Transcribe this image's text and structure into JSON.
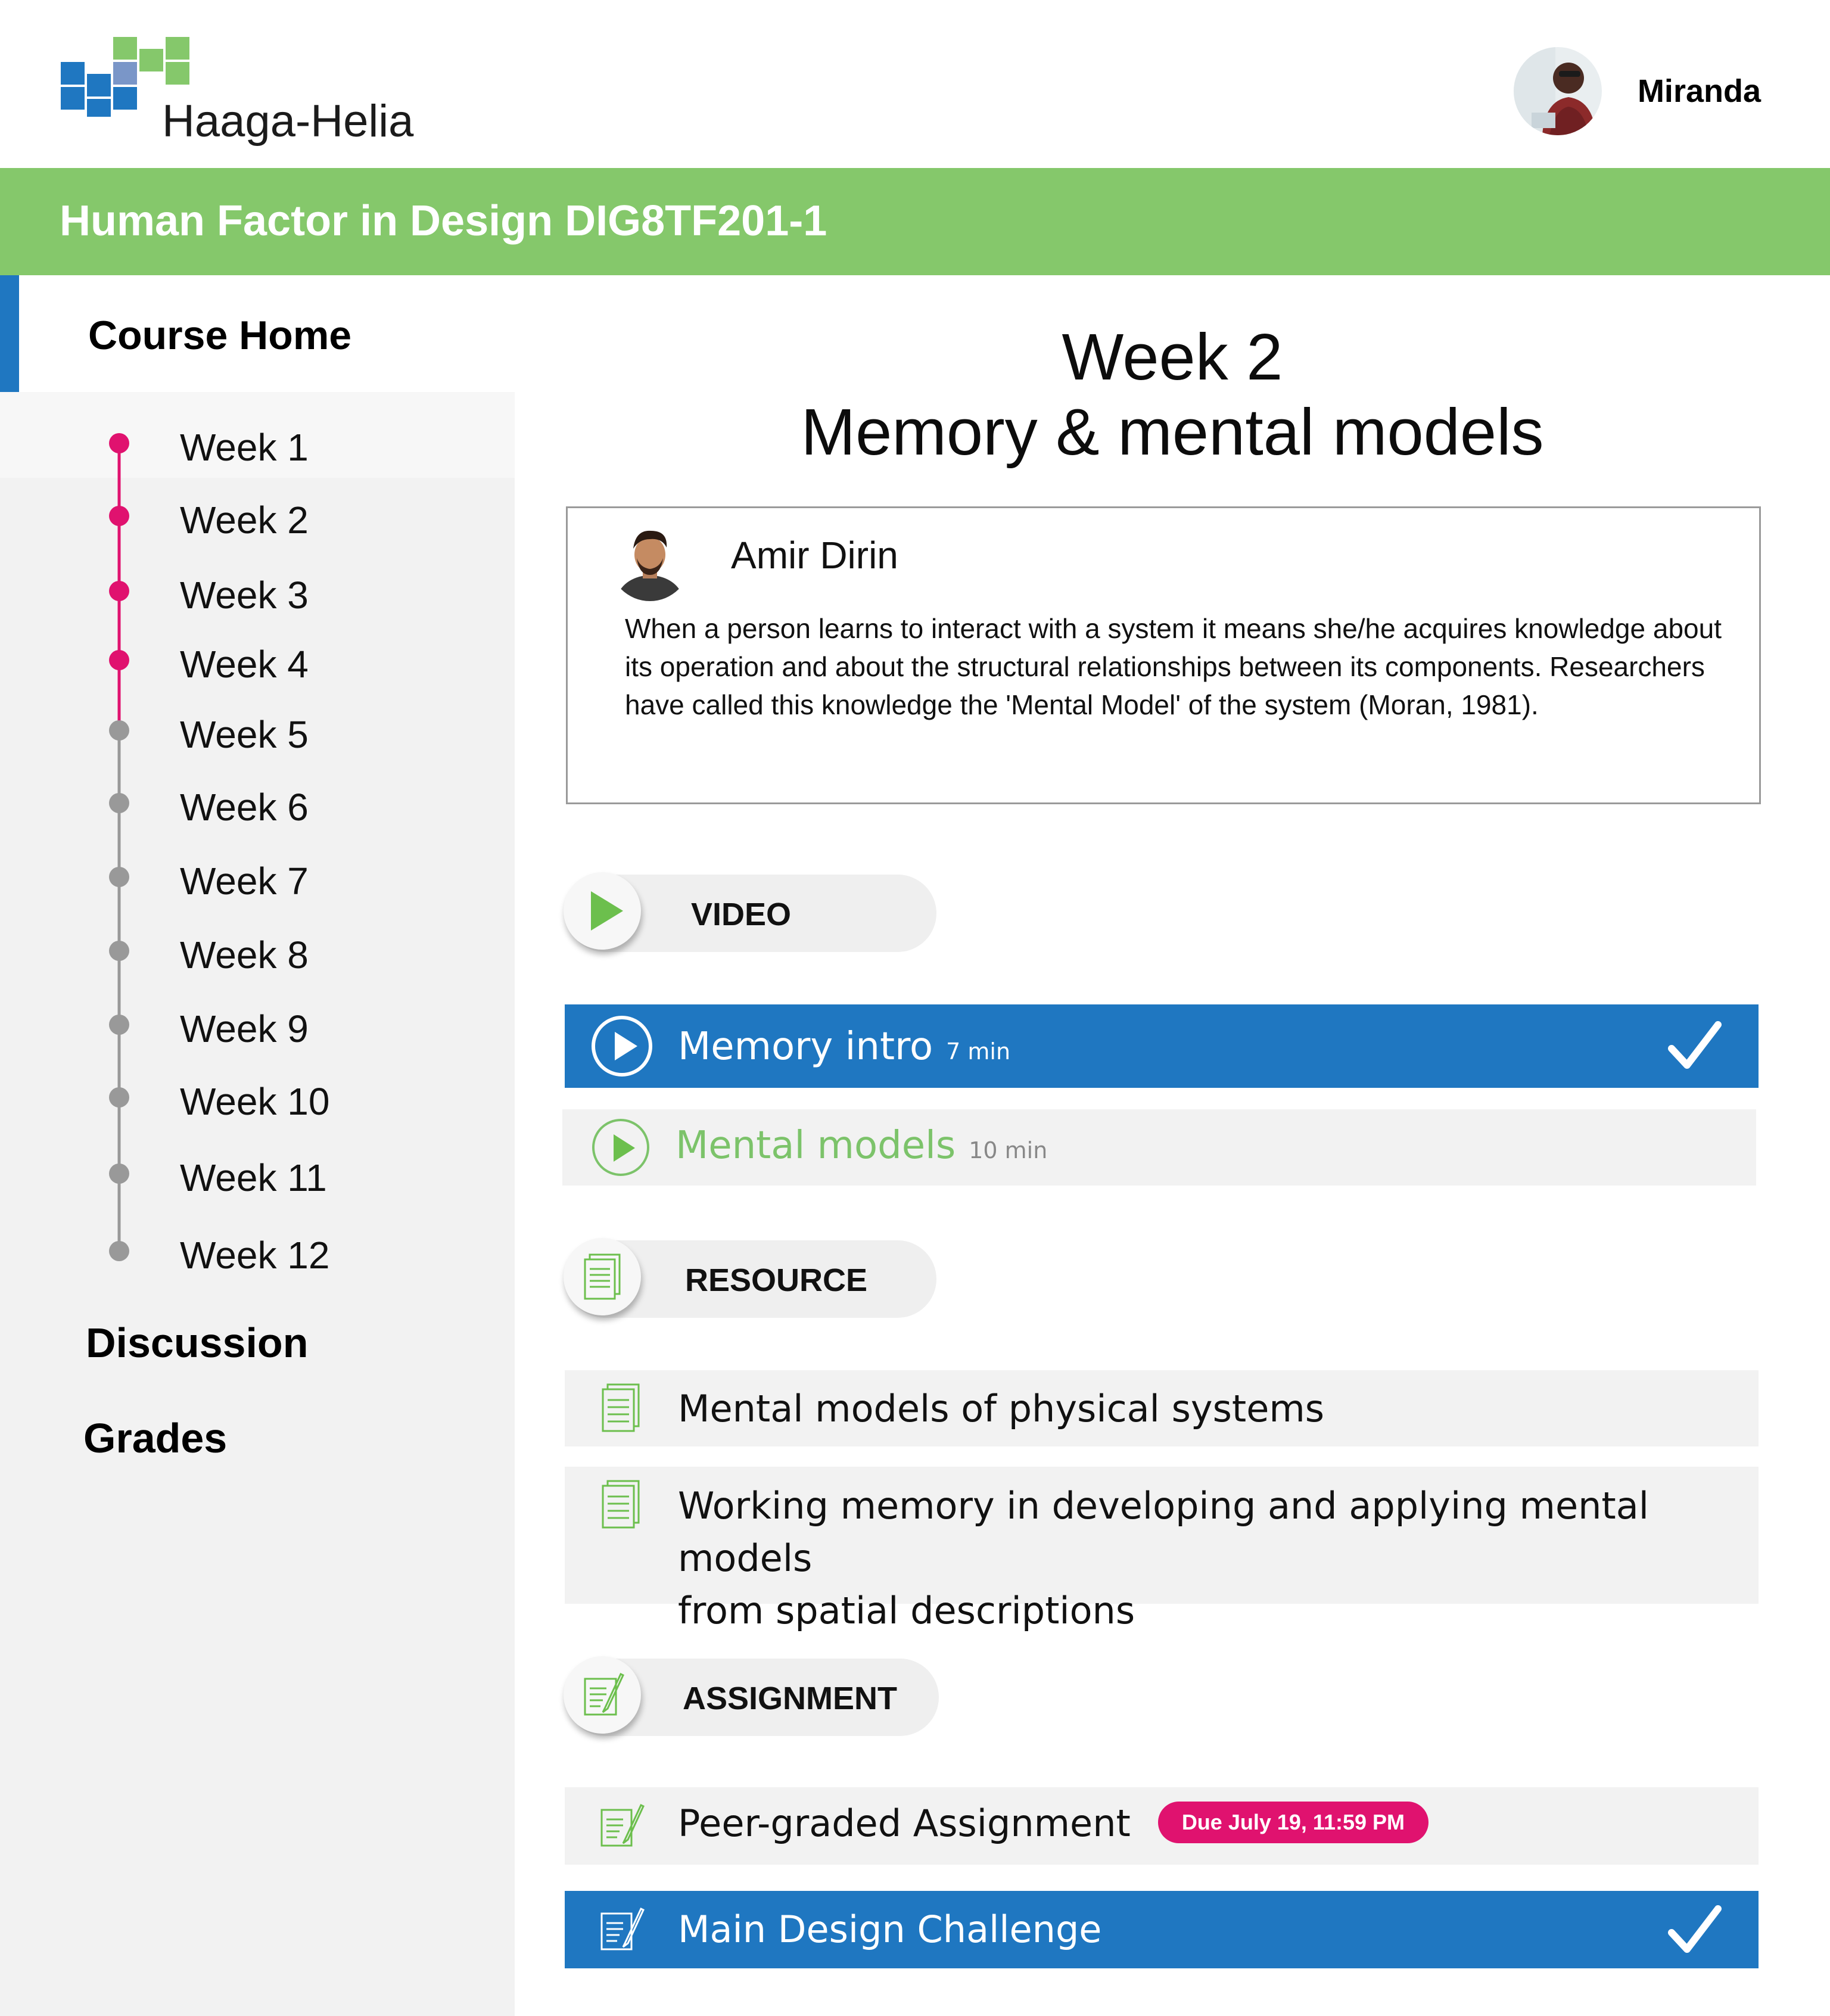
{
  "brand": {
    "name": "Haaga-Helia"
  },
  "user": {
    "name": "Miranda"
  },
  "course": {
    "title": "Human Factor in Design DIG8TF201-1"
  },
  "sidebar": {
    "home_label": "Course Home",
    "weeks": [
      {
        "label": "Week 1",
        "completed": true
      },
      {
        "label": "Week 2",
        "completed": true
      },
      {
        "label": "Week 3",
        "completed": true
      },
      {
        "label": "Week 4",
        "completed": true
      },
      {
        "label": "Week 5",
        "completed": false
      },
      {
        "label": "Week 6",
        "completed": false
      },
      {
        "label": "Week 7",
        "completed": false
      },
      {
        "label": "Week 8",
        "completed": false
      },
      {
        "label": "Week 9",
        "completed": false
      },
      {
        "label": "Week 10",
        "completed": false
      },
      {
        "label": "Week 11",
        "completed": false
      },
      {
        "label": "Week 12",
        "completed": false
      }
    ],
    "discussion_label": "Discussion",
    "grades_label": "Grades"
  },
  "main": {
    "week_title": "Week 2",
    "week_subtitle": "Memory & mental models",
    "instructor": {
      "name": "Amir Dirin",
      "description": "When a person learns to interact with a system it means she/he acquires knowledge about its operation and about the structural relationships between its components. Researchers have called this knowledge the 'Mental Model' of the system (Moran, 1981)."
    },
    "sections": {
      "video": {
        "label": "VIDEO",
        "items": [
          {
            "title": "Memory intro",
            "duration": "7 min",
            "completed": true
          },
          {
            "title": "Mental models",
            "duration": "10 min",
            "completed": false
          }
        ]
      },
      "resource": {
        "label": "RESOURCE",
        "items": [
          {
            "title_line1": "Mental models of physical systems"
          },
          {
            "title_line1": "Working memory in developing and applying mental models",
            "title_line2": "from spatial descriptions"
          }
        ]
      },
      "assignment": {
        "label": "ASSIGNMENT",
        "items": [
          {
            "title": "Peer-graded Assignment",
            "due": "Due July 19, 11:59 PM",
            "completed": false
          },
          {
            "title": "Main Design Challenge",
            "completed": true
          }
        ]
      }
    }
  },
  "colors": {
    "brand_green": "#85c86b",
    "accent_blue": "#1f77c1",
    "progress_pink": "#e0126f",
    "inactive_grey": "#999999",
    "pending_green": "#7cc36a"
  },
  "icons": {
    "logo": "haaga-helia-squares-logo",
    "play": "play-icon",
    "document": "document-icon",
    "assignment": "edit-document-icon",
    "check": "checkmark-icon"
  }
}
